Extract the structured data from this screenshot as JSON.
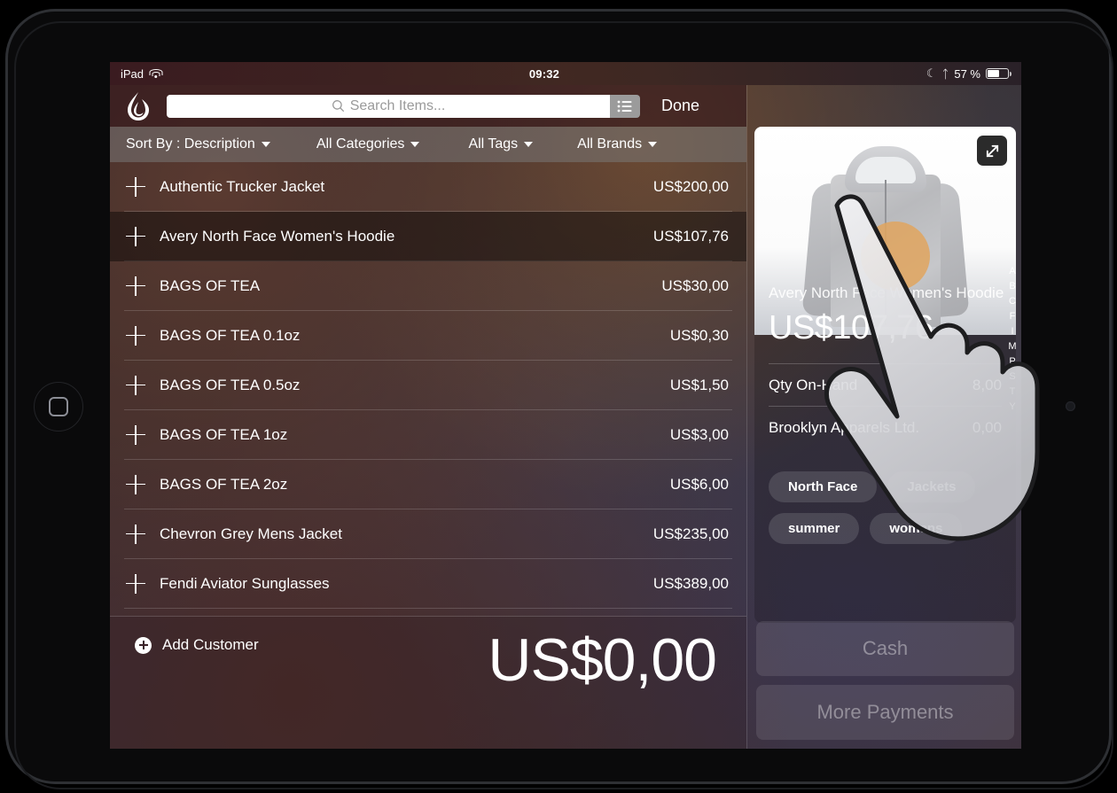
{
  "status_bar": {
    "device_label": "iPad",
    "wifi_icon": "wifi-icon",
    "time": "09:32",
    "dnd_icon": "moon-icon",
    "bluetooth_icon": "bluetooth-icon",
    "battery_percent": "57 %",
    "battery_icon": "battery-icon"
  },
  "nav": {
    "logo_icon": "lightspeed-logo-icon",
    "search_placeholder": "Search Items...",
    "search_value": "",
    "search_icon": "search-icon",
    "list_mode_icon": "list-icon",
    "done_label": "Done"
  },
  "filters": [
    {
      "label": "Sort By : Description",
      "name": "sort-by"
    },
    {
      "label": "All Categories",
      "name": "categories"
    },
    {
      "label": "All Tags",
      "name": "tags"
    },
    {
      "label": "All Brands",
      "name": "brands"
    }
  ],
  "items": [
    {
      "name": "Authentic Trucker Jacket",
      "price": "US$200,00",
      "selected": false
    },
    {
      "name": "Avery North Face Women's Hoodie",
      "price": "US$107,76",
      "selected": true
    },
    {
      "name": "BAGS OF TEA",
      "price": "US$30,00",
      "selected": false
    },
    {
      "name": "BAGS OF TEA 0.1oz",
      "price": "US$0,30",
      "selected": false
    },
    {
      "name": "BAGS OF TEA 0.5oz",
      "price": "US$1,50",
      "selected": false
    },
    {
      "name": "BAGS OF TEA 1oz",
      "price": "US$3,00",
      "selected": false
    },
    {
      "name": "BAGS OF TEA 2oz",
      "price": "US$6,00",
      "selected": false
    },
    {
      "name": "Chevron Grey Mens Jacket",
      "price": "US$235,00",
      "selected": false
    },
    {
      "name": "Fendi Aviator Sunglasses",
      "price": "US$389,00",
      "selected": false
    }
  ],
  "alpha_index": [
    "A",
    "B",
    "C",
    "F",
    "I",
    "M",
    "P",
    "S",
    "T",
    "Y"
  ],
  "bottom": {
    "add_customer_label": "Add Customer",
    "add_customer_icon": "plus-circle-icon",
    "order_total": "US$0,00"
  },
  "product": {
    "title": "Avery North Face Women's Hoodie",
    "price": "US$107,76",
    "expand_icon": "expand-icon",
    "image_alt": "grey-hoodie-image",
    "details": [
      {
        "label": "Qty On-Hand",
        "value": "8,00"
      },
      {
        "label": "Brooklyn Apparels Ltd.",
        "value": "0,00"
      }
    ],
    "tags": [
      "North Face",
      "Jackets",
      "summer",
      "womens"
    ]
  },
  "payments": [
    {
      "label": "Cash",
      "name": "cash-button"
    },
    {
      "label": "More Payments",
      "name": "more-payments-button"
    }
  ],
  "colors": {
    "nav_bar": "#34161c",
    "filter_bar": "#7a7a7a",
    "touch_indicator": "#e0a45e",
    "selected_row_overlay": "rgba(0,0,0,0.42)"
  }
}
